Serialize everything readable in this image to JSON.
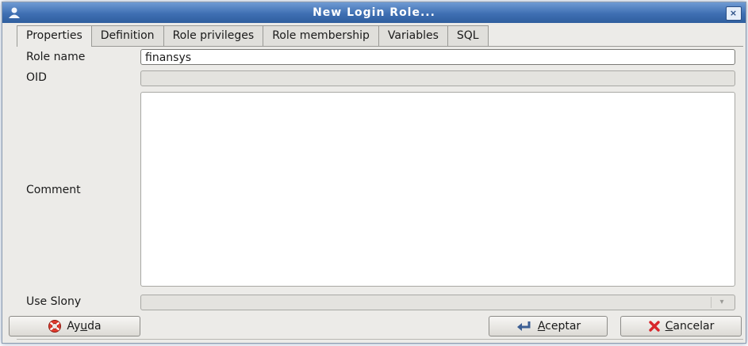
{
  "window": {
    "title": "New Login Role...",
    "close_glyph": "×"
  },
  "tabs": [
    {
      "label": "Properties",
      "active": true
    },
    {
      "label": "Definition",
      "active": false
    },
    {
      "label": "Role privileges",
      "active": false
    },
    {
      "label": "Role membership",
      "active": false
    },
    {
      "label": "Variables",
      "active": false
    },
    {
      "label": "SQL",
      "active": false
    }
  ],
  "form": {
    "role_name": {
      "label": "Role name",
      "value": "finansys"
    },
    "oid": {
      "label": "OID",
      "value": ""
    },
    "comment": {
      "label": "Comment",
      "value": ""
    },
    "use_slony": {
      "label": "Use Slony",
      "value": "",
      "arrow_glyph": "▾"
    }
  },
  "buttons": {
    "help": {
      "label_pre": "Ay",
      "mnemonic": "u",
      "label_post": "da",
      "icon": "lifebuoy-icon"
    },
    "ok": {
      "label_pre": "",
      "mnemonic": "A",
      "label_post": "ceptar",
      "icon": "return-arrow-icon"
    },
    "cancel": {
      "label_pre": "",
      "mnemonic": "C",
      "label_post": "ancelar",
      "icon": "red-x-icon"
    }
  },
  "colors": {
    "titlebar": "#3f6fb3",
    "window_bg": "#ecebe8",
    "cancel_x": "#d8262b",
    "help_red": "#e23b2e"
  }
}
